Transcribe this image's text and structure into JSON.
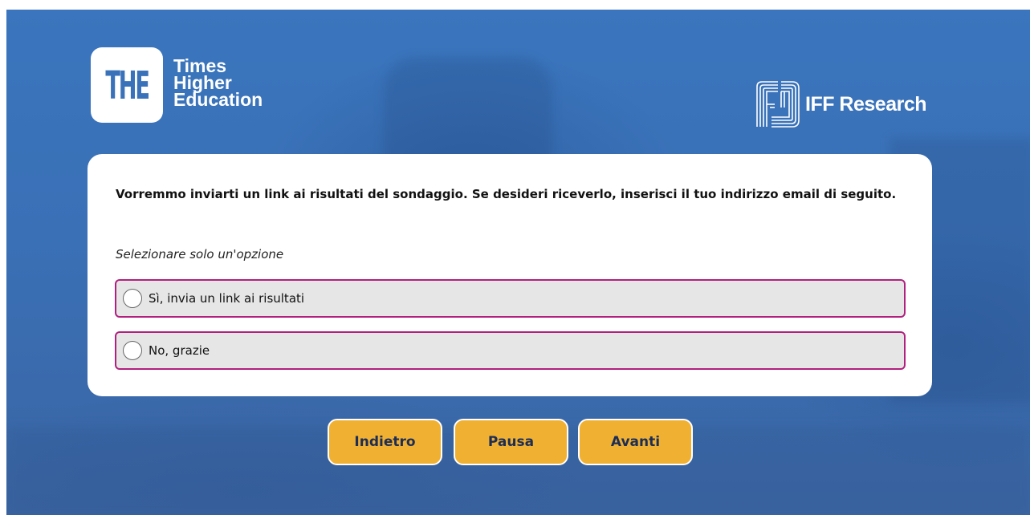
{
  "branding": {
    "the_mark": "THE",
    "the_words": [
      "Times",
      "Higher",
      "Education"
    ],
    "iff_name": "IFF Research",
    "colors": {
      "background": "#3a72ba",
      "accent_button": "#f0b132",
      "option_border": "#b1207f",
      "option_fill": "#e6e6e6"
    }
  },
  "survey": {
    "question": "Vorremmo inviarti un link ai risultati del sondaggio. Se desideri riceverlo, inserisci il tuo indirizzo email di seguito.",
    "instruction": "Selezionare solo un'opzione",
    "options": [
      {
        "label": "Sì, invia un link ai risultati",
        "selected": false
      },
      {
        "label": "No, grazie",
        "selected": false
      }
    ]
  },
  "navigation": {
    "back_label": "Indietro",
    "pause_label": "Pausa",
    "next_label": "Avanti"
  }
}
